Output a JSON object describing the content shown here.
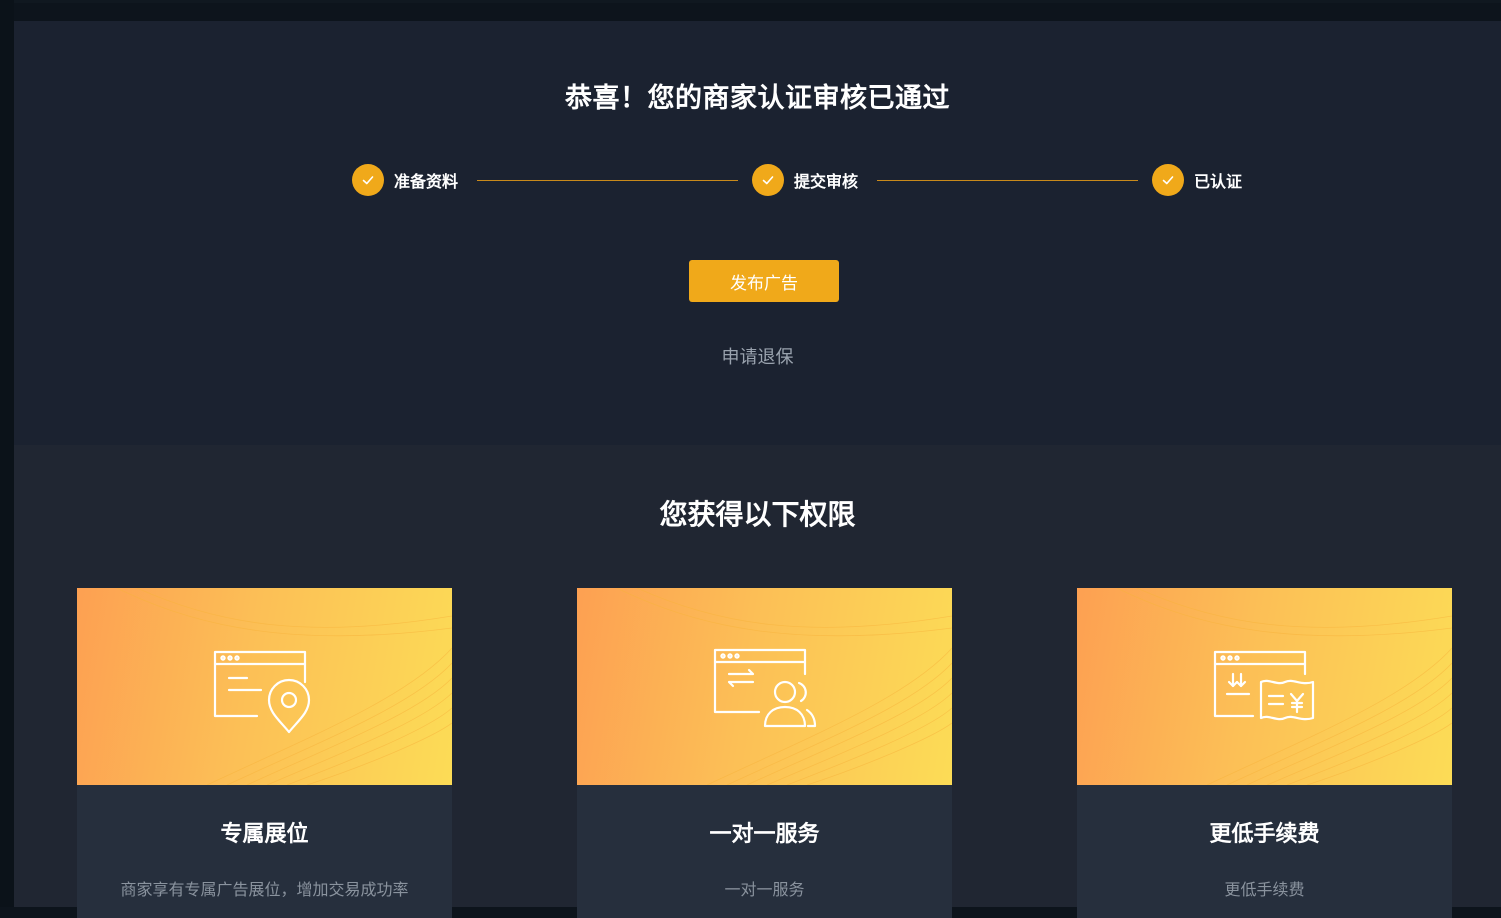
{
  "header": {
    "title": "恭喜！您的商家认证审核已通过"
  },
  "steps": [
    {
      "label": "准备资料"
    },
    {
      "label": "提交审核"
    },
    {
      "label": "已认证"
    }
  ],
  "actions": {
    "publish_label": "发布广告",
    "withdraw_label": "申请退保"
  },
  "privileges": {
    "title": "您获得以下权限",
    "cards": [
      {
        "title": "专属展位",
        "desc": "商家享有专属广告展位，增加交易成功率",
        "icon": "ad-location-icon"
      },
      {
        "title": "一对一服务",
        "desc": "一对一服务",
        "icon": "exchange-users-icon"
      },
      {
        "title": "更低手续费",
        "desc": "更低手续费",
        "icon": "fee-yen-icon"
      }
    ]
  },
  "colors": {
    "accent": "#f0a91a",
    "upper_bg": "#1b2230",
    "lower_bg": "#202632",
    "card_bg": "#262f3d"
  }
}
